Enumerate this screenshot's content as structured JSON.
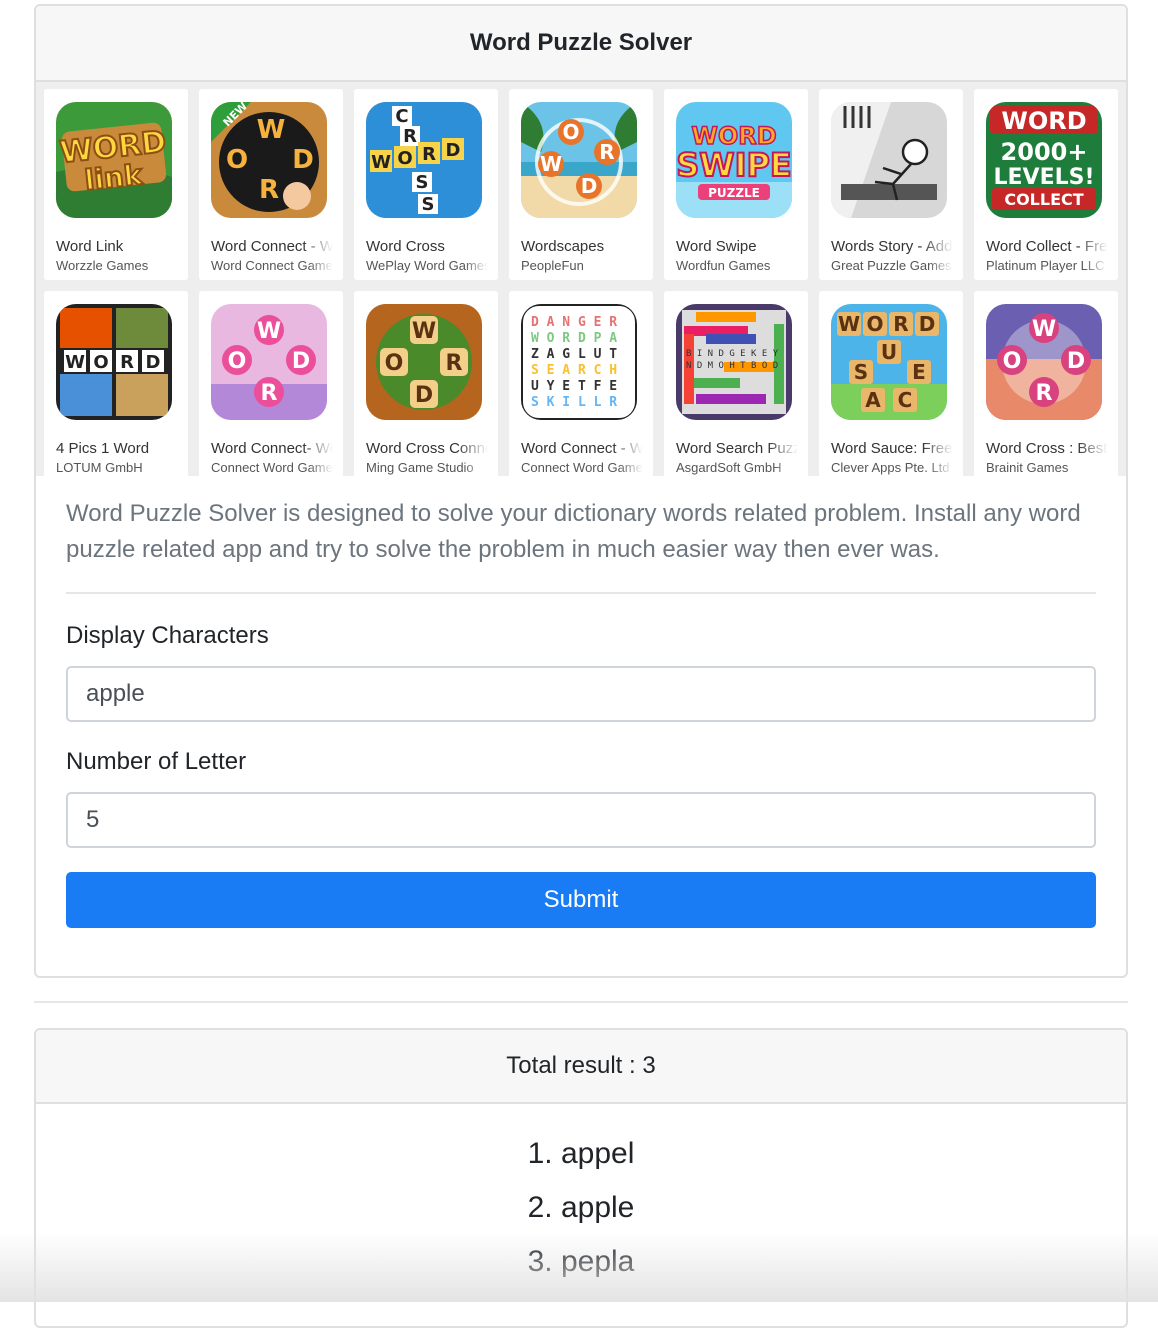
{
  "header": {
    "title": "Word Puzzle Solver"
  },
  "apps": [
    {
      "name": "Word Link",
      "developer": "Worzzle Games",
      "icon": "word-link-icon"
    },
    {
      "name": "Word Connect - Word Games Puzzle",
      "developer": "Word Connect Games",
      "icon": "word-connect-icon"
    },
    {
      "name": "Word Cross",
      "developer": "WePlay Word Games",
      "icon": "word-cross-icon"
    },
    {
      "name": "Wordscapes",
      "developer": "PeopleFun",
      "icon": "wordscapes-icon"
    },
    {
      "name": "Word Swipe",
      "developer": "Wordfun Games",
      "icon": "word-swipe-icon"
    },
    {
      "name": "Words Story - Addictive Word Game",
      "developer": "Great Puzzle Games",
      "icon": "words-story-icon"
    },
    {
      "name": "Word Collect - Free Word Games",
      "developer": "Platinum Player LLC",
      "icon": "word-collect-icon"
    },
    {
      "name": "4 Pics 1 Word",
      "developer": "LOTUM GmbH",
      "icon": "four-pics-icon"
    },
    {
      "name": "Word Connect- Word Games Puzzle",
      "developer": "Connect Word Games",
      "icon": "word-connect-2-icon"
    },
    {
      "name": "Word Cross Connect",
      "developer": "Ming Game Studio",
      "icon": "word-cross-connect-icon"
    },
    {
      "name": "Word Connect - Word Search",
      "developer": "Connect Word Games",
      "icon": "word-connect-search-icon"
    },
    {
      "name": "Word Search Puzzle",
      "developer": "AsgardSoft GmbH",
      "icon": "word-search-icon"
    },
    {
      "name": "Word Sauce: Free Word Connect",
      "developer": "Clever Apps Pte. Ltd",
      "icon": "word-sauce-icon"
    },
    {
      "name": "Word Cross : Best Word Games",
      "developer": "Brainit Games",
      "icon": "word-cross-best-icon"
    }
  ],
  "description": "Word Puzzle Solver is designed to solve your dictionary words related problem. Install any word puzzle related app and try to solve the problem in much easier way then ever was.",
  "form": {
    "characters_label": "Display Characters",
    "characters_value": "apple",
    "letters_label": "Number of Letter",
    "letters_value": "5",
    "submit_label": "Submit"
  },
  "result": {
    "total_label": "Total result : 3",
    "items": [
      "1. appel",
      "2. apple",
      "3. pepla"
    ]
  },
  "colors": {
    "accent": "#1a7cf5",
    "header_bg": "#f7f7f7",
    "grid_bg": "#eeeeee"
  }
}
